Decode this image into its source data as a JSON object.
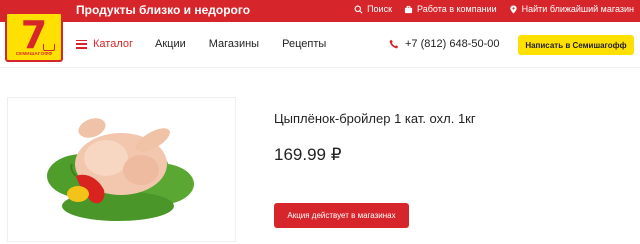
{
  "header": {
    "tagline": "Продукты близко и недорого",
    "logo_text": "СЕМИШАГОФФ",
    "links": {
      "search": "Поиск",
      "jobs": "Работа в компании",
      "find_store": "Найти ближайший магазин"
    }
  },
  "nav": {
    "catalog": "Каталог",
    "items": [
      "Акции",
      "Магазины",
      "Рецепты"
    ],
    "phone": "+7 (812) 648-50-00",
    "write_button": "Написать в Семишагофф"
  },
  "product": {
    "title": "Цыплёнок-бройлер 1 кат. охл. 1кг",
    "price": "169.99 ₽",
    "promo_button": "Акция действует в магазинах"
  },
  "colors": {
    "brand_red": "#d7262b",
    "brand_yellow": "#ffe000"
  }
}
